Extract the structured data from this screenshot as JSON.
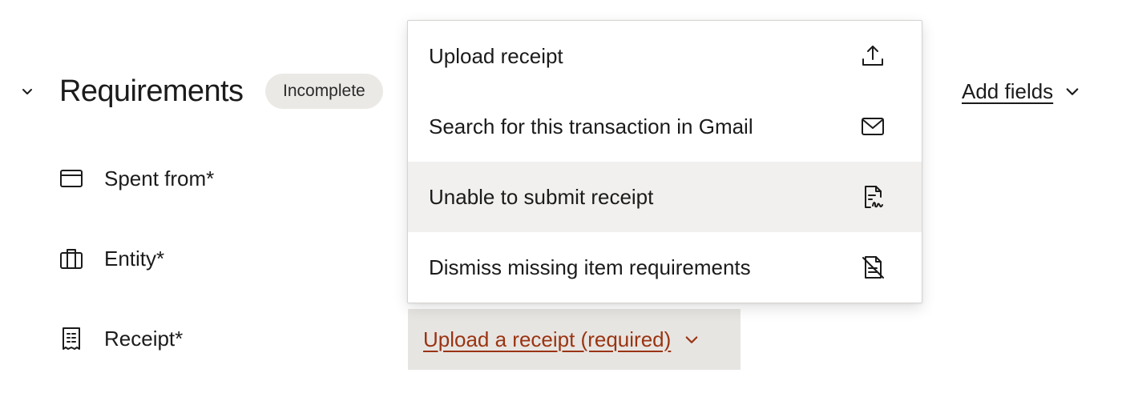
{
  "requirements": {
    "title": "Requirements",
    "status": "Incomplete",
    "add_fields_label": "Add fields"
  },
  "fields": [
    {
      "label": "Spent from*",
      "icon": "card-icon"
    },
    {
      "label": "Entity*",
      "icon": "briefcase-icon"
    },
    {
      "label": "Receipt*",
      "icon": "receipt-icon"
    }
  ],
  "receipt_dropdown": {
    "label": "Upload a receipt (required)",
    "color": "#9a3412"
  },
  "menu": {
    "items": [
      {
        "label": "Upload receipt",
        "icon": "upload-icon"
      },
      {
        "label": "Search for this transaction in Gmail",
        "icon": "mail-icon"
      },
      {
        "label": "Unable to submit receipt",
        "icon": "document-signature-icon",
        "highlighted": true
      },
      {
        "label": "Dismiss missing item requirements",
        "icon": "document-off-icon"
      }
    ]
  }
}
